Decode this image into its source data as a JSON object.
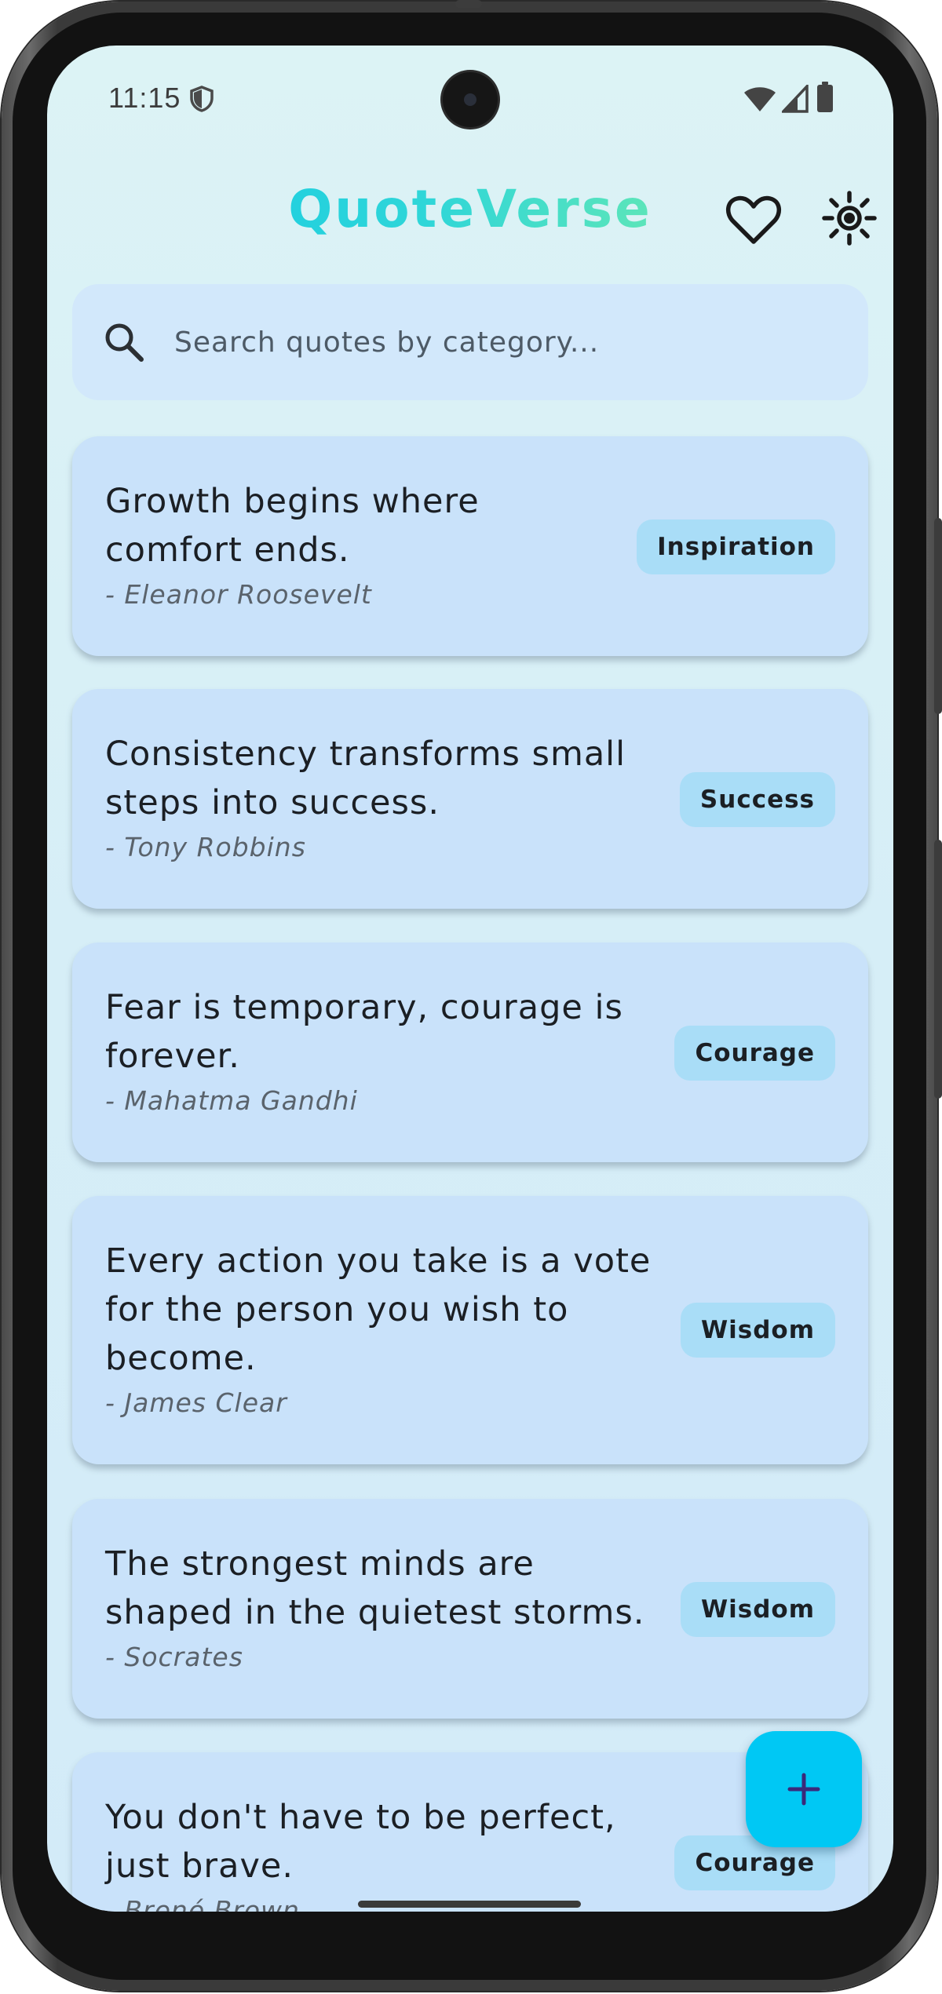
{
  "status_bar": {
    "time": "11:15",
    "icons": [
      "shield-icon",
      "wifi-icon",
      "signal-icon",
      "battery-icon"
    ]
  },
  "app_bar": {
    "title": "QuoteVerse",
    "title_gradient": [
      "#10c8e8",
      "#9af3a8"
    ],
    "actions": [
      "heart-icon",
      "sun-icon"
    ]
  },
  "search": {
    "placeholder": "Search quotes by category...",
    "value": ""
  },
  "quotes": [
    {
      "text_lines": [
        "Growth begins where",
        "comfort ends."
      ],
      "author": "- Eleanor Roosevelt",
      "category": "Inspiration"
    },
    {
      "text_lines": [
        "Consistency transforms small",
        "steps into success."
      ],
      "author": "- Tony Robbins",
      "category": "Success"
    },
    {
      "text_lines": [
        "Fear is temporary, courage is",
        "forever."
      ],
      "author": "- Mahatma Gandhi",
      "category": "Courage"
    },
    {
      "text_lines": [
        "Every action you take is a vote",
        "for the person you wish to",
        "become."
      ],
      "author": "- James Clear",
      "category": "Wisdom"
    },
    {
      "text_lines": [
        "The strongest minds are",
        "shaped in the quietest storms."
      ],
      "author": "- Socrates",
      "category": "Wisdom"
    },
    {
      "text_lines": [
        "You don't have to be perfect,",
        "just brave."
      ],
      "author": "- Brené Brown",
      "category": "Courage"
    }
  ],
  "fab": {
    "icon": "plus-icon",
    "color": "#00c8f4"
  },
  "colors": {
    "background": "#dcf3f5",
    "card": "#c9e2fa",
    "chip": "#a9ddf7",
    "search": "#d2e8fb"
  }
}
